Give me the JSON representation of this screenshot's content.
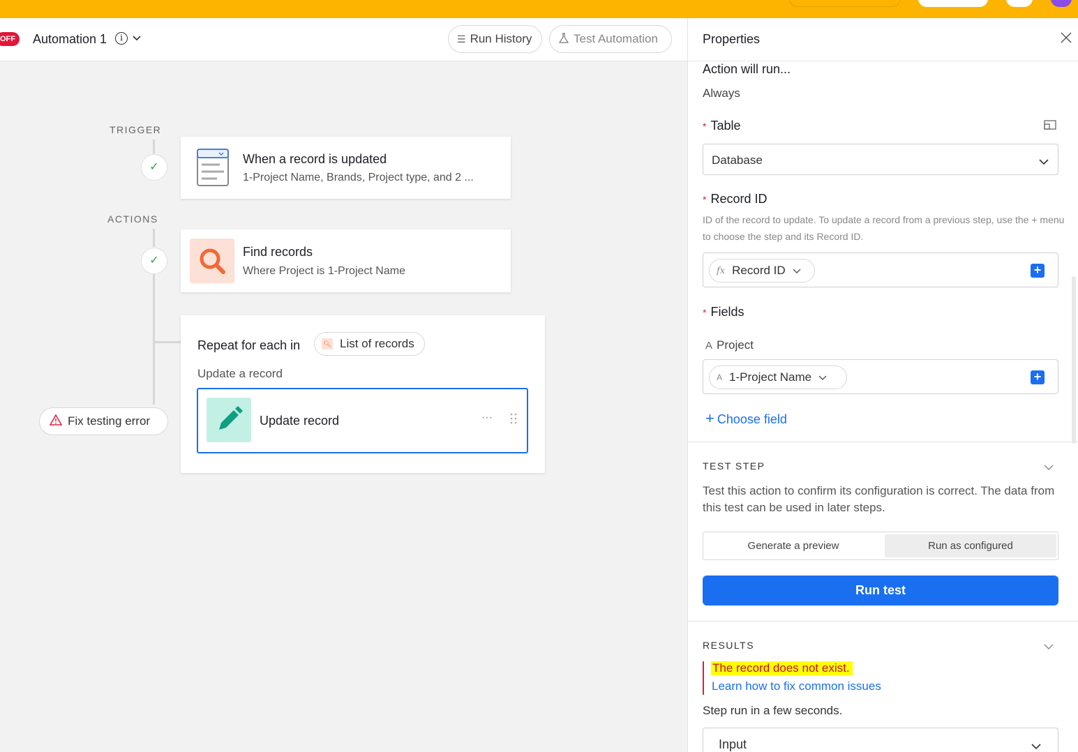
{
  "header": {
    "off_badge": "OFF",
    "title": "Automation 1",
    "run_history": "Run History",
    "test_automation": "Test Automation"
  },
  "canvas": {
    "trigger_label": "TRIGGER",
    "actions_label": "ACTIONS",
    "trigger_card": {
      "title": "When a record is updated",
      "subtitle": "1-Project Name, Brands, Project type, and 2 ..."
    },
    "find_card": {
      "title": "Find records",
      "subtitle": "Where Project is 1-Project Name"
    },
    "repeat_card": {
      "title": "Repeat for each in",
      "chip": "List of records",
      "subtitle": "Update a record",
      "inner_title": "Update record",
      "more": "···"
    },
    "fix_button": "Fix testing error"
  },
  "panel": {
    "title": "Properties",
    "action_runs_label": "Action will run...",
    "action_runs_value": "Always",
    "table_label": "Table",
    "table_value": "Database",
    "record_id_label": "Record ID",
    "record_id_help": "ID of the record to update. To update a record from a previous step, use the + menu to choose the step and its Record ID.",
    "record_id_chip": "Record ID",
    "fields_label": "Fields",
    "project_field_label": "Project",
    "project_chip": "1-Project Name",
    "choose_field": "Choose field",
    "test_step_label": "TEST STEP",
    "test_step_desc": "Test this action to confirm its configuration is correct. The data from this test can be used in later steps.",
    "segments": [
      "Generate a preview",
      "Run as configured"
    ],
    "run_test": "Run test",
    "results_label": "RESULTS",
    "error": "The record does not exist.",
    "learn_link": "Learn how to fix common issues",
    "step_run": "Step run in a few seconds.",
    "input_label": "Input"
  },
  "colors": {
    "topbar": "#fcb400",
    "accent": "#1a6ff0",
    "error": "#d6203b",
    "find_tile": "#fde0d6",
    "update_tile": "#c3f0e5"
  }
}
